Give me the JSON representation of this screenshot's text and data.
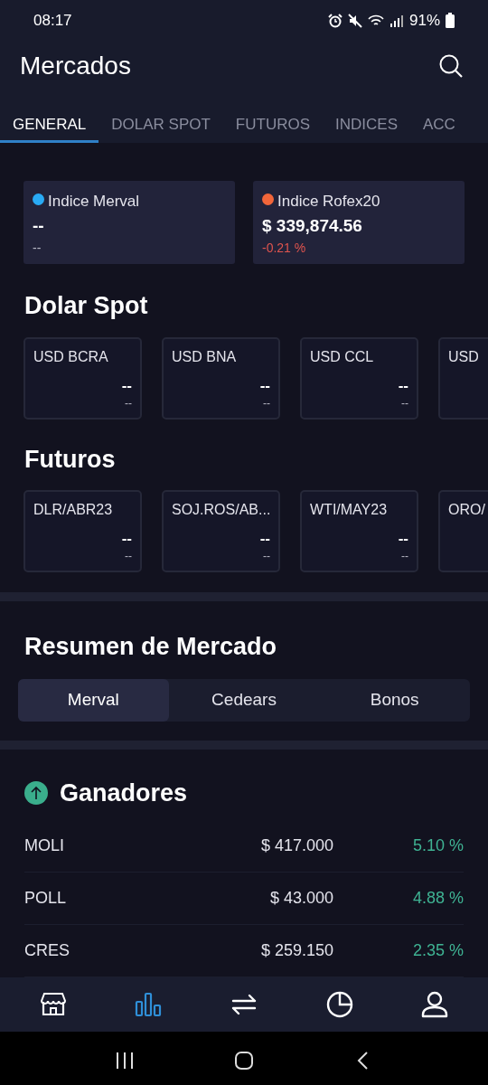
{
  "status_bar": {
    "time": "08:17",
    "battery": "91%"
  },
  "header": {
    "title": "Mercados"
  },
  "tabs": [
    {
      "label": "GENERAL",
      "selected": true
    },
    {
      "label": "DOLAR SPOT",
      "selected": false
    },
    {
      "label": "FUTUROS",
      "selected": false
    },
    {
      "label": "INDICES",
      "selected": false
    },
    {
      "label": "ACC",
      "selected": false
    }
  ],
  "indices": [
    {
      "name": "Indice Merval",
      "color": "#29aaf4",
      "value": "--",
      "change": "--",
      "negative": false
    },
    {
      "name": "Indice Rofex20",
      "color": "#f2663a",
      "value": "$ 339,874.56",
      "change": "-0.21 %",
      "negative": true
    }
  ],
  "dolar_spot": {
    "title": "Dolar Spot",
    "cards": [
      {
        "name": "USD BCRA",
        "value": "--",
        "change": "--"
      },
      {
        "name": "USD BNA",
        "value": "--",
        "change": "--"
      },
      {
        "name": "USD CCL",
        "value": "--",
        "change": "--"
      },
      {
        "name": "USD"
      }
    ]
  },
  "futuros": {
    "title": "Futuros",
    "cards": [
      {
        "name": "DLR/ABR23",
        "value": "--",
        "change": "--"
      },
      {
        "name": "SOJ.ROS/AB...",
        "value": "--",
        "change": "--"
      },
      {
        "name": "WTI/MAY23",
        "value": "--",
        "change": "--"
      },
      {
        "name": "ORO/"
      }
    ]
  },
  "resumen": {
    "title": "Resumen de Mercado",
    "segments": [
      {
        "label": "Merval",
        "selected": true
      },
      {
        "label": "Cedears",
        "selected": false
      },
      {
        "label": "Bonos",
        "selected": false
      }
    ]
  },
  "ganadores": {
    "title": "Ganadores",
    "rows": [
      {
        "ticker": "MOLI",
        "price": "$ 417.000",
        "change": "5.10 %"
      },
      {
        "ticker": "POLL",
        "price": "$ 43.000",
        "change": "4.88 %"
      },
      {
        "ticker": "CRES",
        "price": "$ 259.150",
        "change": "2.35 %"
      }
    ]
  },
  "bottom_nav": [
    {
      "kind": "store",
      "selected": false
    },
    {
      "kind": "chart",
      "selected": true
    },
    {
      "kind": "transfer",
      "selected": false
    },
    {
      "kind": "pie",
      "selected": false
    },
    {
      "kind": "profile",
      "selected": false
    }
  ]
}
